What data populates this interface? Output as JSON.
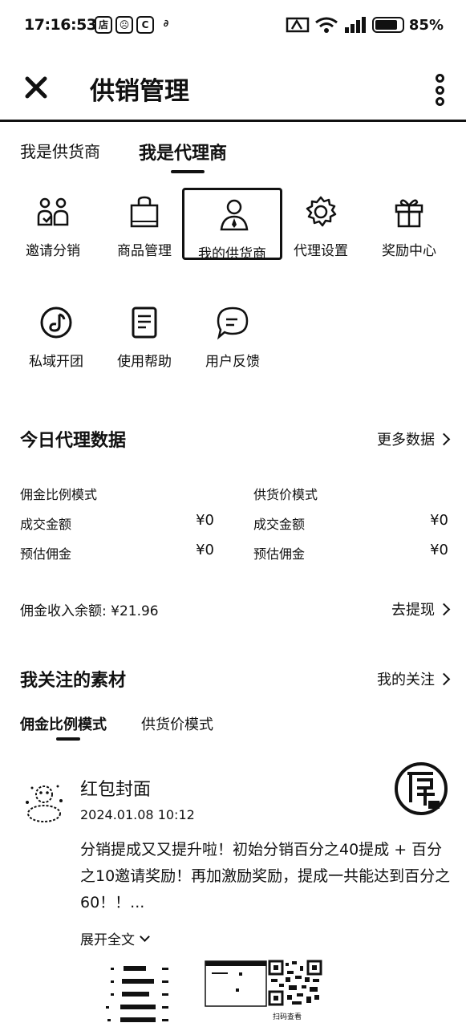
{
  "status_bar": {
    "time": "17:16:53",
    "notif_icons": [
      "店",
      "☹",
      "C",
      "∂"
    ],
    "battery_text": "85%",
    "battery_level": 0.85
  },
  "header": {
    "title": "供销管理"
  },
  "tabs": [
    {
      "label": "我是供货商",
      "active": false
    },
    {
      "label": "我是代理商",
      "active": true
    }
  ],
  "grid": [
    {
      "label": "邀请分销",
      "icon": "invite-users-icon"
    },
    {
      "label": "商品管理",
      "icon": "shopping-bag-icon"
    },
    {
      "label": "我的供货商",
      "icon": "person-icon",
      "selected": true
    },
    {
      "label": "代理设置",
      "icon": "gear-icon"
    },
    {
      "label": "奖励中心",
      "icon": "gift-icon"
    },
    {
      "label": "私域开团",
      "icon": "music-note-circle-icon"
    },
    {
      "label": "使用帮助",
      "icon": "document-icon"
    },
    {
      "label": "用户反馈",
      "icon": "feedback-bubble-icon"
    }
  ],
  "today_data": {
    "title": "今日代理数据",
    "more_link": "更多数据",
    "left": {
      "mode": "佣金比例模式",
      "rows": [
        {
          "label": "成交金额",
          "value": "¥0"
        },
        {
          "label": "预估佣金",
          "value": "¥0"
        }
      ]
    },
    "right": {
      "mode": "供货价模式",
      "rows": [
        {
          "label": "成交金额",
          "value": "¥0"
        },
        {
          "label": "预估佣金",
          "value": "¥0"
        }
      ]
    },
    "balance_text": "佣金收入余额: ¥21.96",
    "withdraw_link": "去提现"
  },
  "materials": {
    "title": "我关注的素材",
    "link": "我的关注",
    "tabs": [
      {
        "label": "佣金比例模式",
        "active": true
      },
      {
        "label": "供货价模式",
        "active": false
      }
    ],
    "post": {
      "name": "红包封面",
      "time": "2024.01.08 10:12",
      "content": "分销提成又又提升啦！初始分销百分之40提成 + 百分之10邀请奖励！再加激励奖励，提成一共能达到百分之60！！...",
      "expand": "展开全文",
      "qr_label": "扫码查看"
    }
  }
}
